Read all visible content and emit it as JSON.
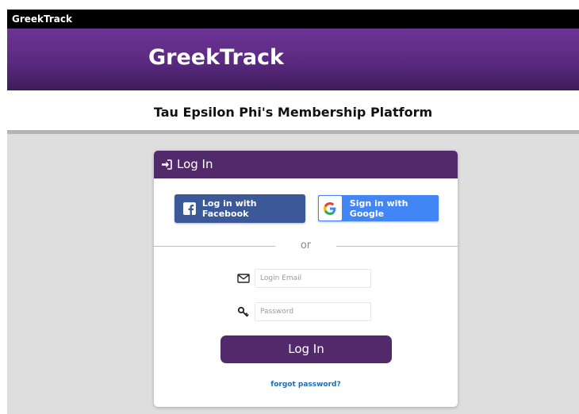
{
  "topbar": {
    "title": "GreekTrack"
  },
  "banner": {
    "title": "GreekTrack"
  },
  "subheader": {
    "title": "Tau Epsilon Phi's Membership Platform"
  },
  "login_card": {
    "header_icon": "sign-in-icon",
    "header_label": "Log In",
    "facebook_button": {
      "label": "Log in with Facebook",
      "icon": "facebook-icon"
    },
    "google_button": {
      "label": "Sign in with Google",
      "icon": "google-icon"
    },
    "divider_text": "or",
    "email_field": {
      "placeholder": "Login Email",
      "value": "",
      "icon": "envelope-icon"
    },
    "password_field": {
      "placeholder": "Password",
      "value": "",
      "icon": "key-icon"
    },
    "submit_label": "Log In",
    "forgot_link": "forgot password?"
  },
  "colors": {
    "brand_purple": "#522a6b",
    "banner_purple": "#5a2980",
    "facebook_blue": "#3b5998",
    "google_blue": "#4285f4",
    "link_blue": "#1f6bb3",
    "page_gray": "#dedede"
  }
}
